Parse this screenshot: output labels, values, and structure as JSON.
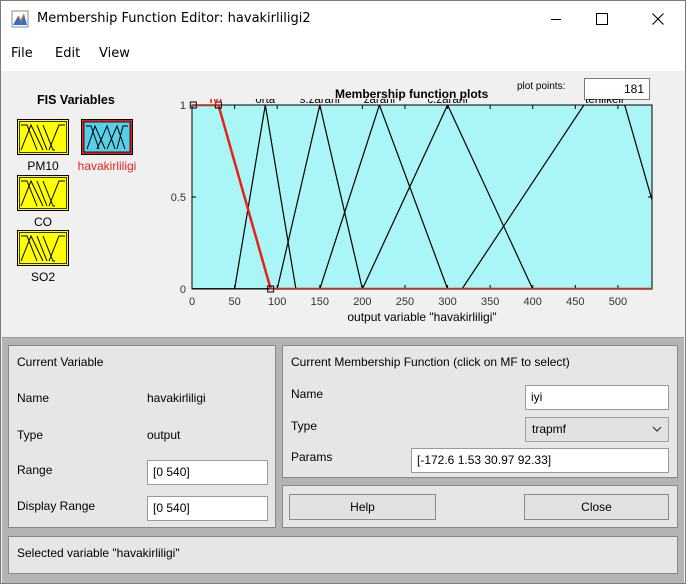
{
  "window": {
    "title": "Membership Function Editor: havakirliligi2",
    "minimize_icon": "minimize-icon",
    "maximize_icon": "maximize-icon",
    "close_icon": "close-icon"
  },
  "menu": {
    "file": "File",
    "edit": "Edit",
    "view": "View"
  },
  "fis_variables": {
    "title": "FIS Variables",
    "inputs": [
      "PM10",
      "CO",
      "SO2"
    ],
    "output": "havakirliligi",
    "selected": "havakirliligi"
  },
  "plot": {
    "title": "Membership function plots",
    "plot_points_label": "plot points:",
    "plot_points_value": "181",
    "xlabel": "output variable \"havakirliligi\""
  },
  "chart_data": {
    "type": "line",
    "title": "Membership function plots",
    "xlabel": "output variable \"havakirliligi\"",
    "ylabel": "",
    "xlim": [
      0,
      540
    ],
    "ylim": [
      0,
      1
    ],
    "xticks": [
      "0",
      "50",
      "100",
      "150",
      "200",
      "250",
      "300",
      "350",
      "400",
      "450",
      "500"
    ],
    "yticks": [
      "0",
      "0.5",
      "1"
    ],
    "background": "#aaf5f5",
    "selected_color": "#e8211a",
    "series": [
      {
        "name": "iyi",
        "shape": "trapmf",
        "points": [
          [
            -172.6,
            0
          ],
          [
            1.53,
            1
          ],
          [
            30.97,
            1
          ],
          [
            92.33,
            0
          ]
        ],
        "selected": true
      },
      {
        "name": "orta",
        "shape": "trimf",
        "points": [
          [
            50,
            0
          ],
          [
            86,
            1
          ],
          [
            122,
            0
          ]
        ]
      },
      {
        "name": "s.zararli",
        "shape": "trimf",
        "points": [
          [
            100,
            0
          ],
          [
            150,
            1
          ],
          [
            200,
            0
          ]
        ]
      },
      {
        "name": "zararli",
        "shape": "trimf",
        "points": [
          [
            150,
            0
          ],
          [
            220,
            1
          ],
          [
            300,
            0
          ]
        ]
      },
      {
        "name": "c.zararli",
        "shape": "trimf",
        "points": [
          [
            200,
            0
          ],
          [
            300,
            1
          ],
          [
            400,
            0
          ]
        ]
      },
      {
        "name": "tehlikeli",
        "shape": "trapmf",
        "points": [
          [
            317,
            0
          ],
          [
            460,
            1
          ],
          [
            508,
            1
          ],
          [
            570,
            0
          ]
        ]
      }
    ]
  },
  "current_variable": {
    "title": "Current Variable",
    "name_label": "Name",
    "name_value": "havakirliligi",
    "type_label": "Type",
    "type_value": "output",
    "range_label": "Range",
    "range_value": "[0 540]",
    "display_range_label": "Display Range",
    "display_range_value": "[0 540]"
  },
  "current_mf": {
    "title": "Current Membership Function (click on MF to select)",
    "name_label": "Name",
    "name_value": "iyi",
    "type_label": "Type",
    "type_value": "trapmf",
    "params_label": "Params",
    "params_value": "[-172.6 1.53 30.97 92.33]"
  },
  "buttons": {
    "help": "Help",
    "close": "Close"
  },
  "status": "Selected variable \"havakirliligi\""
}
